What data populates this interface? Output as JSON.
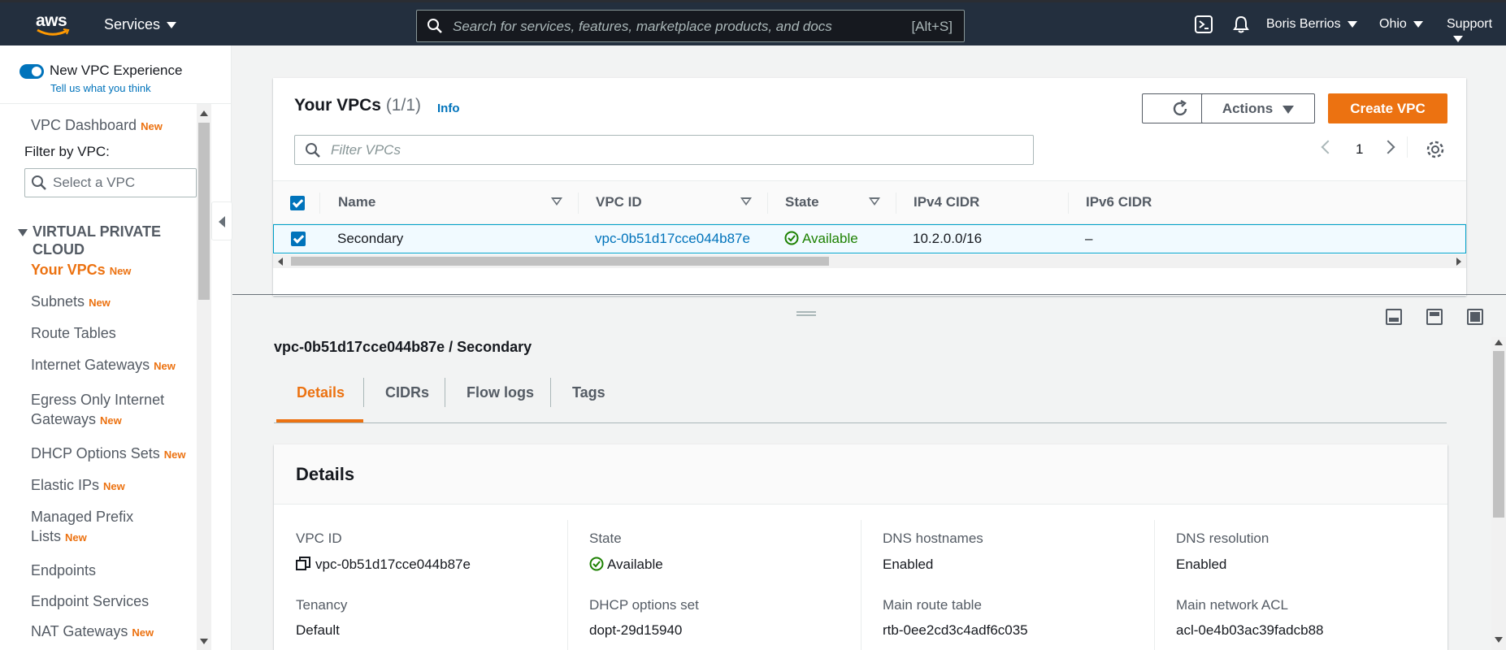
{
  "topbar": {
    "logo_text": "aws",
    "services_label": "Services",
    "search_placeholder": "Search for services, features, marketplace products, and docs",
    "search_shortcut": "[Alt+S]",
    "user_name": "Boris Berrios",
    "region": "Ohio",
    "support": "Support"
  },
  "sidebar": {
    "new_vpc_experience": "New VPC Experience",
    "tell_us": "Tell us what you think",
    "vpc_dashboard": "VPC Dashboard",
    "new_badge": "New",
    "filter_label": "Filter by VPC:",
    "select_placeholder": "Select a VPC",
    "section_title_1": "VIRTUAL PRIVATE",
    "section_title_2": "CLOUD",
    "items": [
      {
        "label": "Your VPCs",
        "badge": "New"
      },
      {
        "label": "Subnets",
        "badge": "New"
      },
      {
        "label": "Route Tables",
        "badge": ""
      },
      {
        "label": "Internet Gateways",
        "badge": "New"
      },
      {
        "label": "Egress Only Internet",
        "label2": "Gateways",
        "badge": "New"
      },
      {
        "label": "DHCP Options Sets",
        "badge": "New"
      },
      {
        "label": "Elastic IPs",
        "badge": "New"
      },
      {
        "label": "Managed Prefix",
        "label2": "Lists",
        "badge": "New"
      },
      {
        "label": "Endpoints",
        "badge": ""
      },
      {
        "label": "Endpoint Services",
        "badge": ""
      },
      {
        "label": "NAT Gateways",
        "badge": "New"
      }
    ]
  },
  "vpcs": {
    "title": "Your VPCs",
    "count": "(1/1)",
    "info": "Info",
    "actions": "Actions",
    "create": "Create VPC",
    "filter_placeholder": "Filter VPCs",
    "page": "1",
    "columns": [
      "Name",
      "VPC ID",
      "State",
      "IPv4 CIDR",
      "IPv6 CIDR"
    ],
    "row": {
      "name": "Secondary",
      "vpc_id": "vpc-0b51d17cce044b87e",
      "state": "Available",
      "ipv4": "10.2.0.0/16",
      "ipv6": "–"
    }
  },
  "detail": {
    "title": "vpc-0b51d17cce044b87e / Secondary",
    "tabs": [
      "Details",
      "CIDRs",
      "Flow logs",
      "Tags"
    ],
    "card_title": "Details",
    "fields": [
      {
        "label": "VPC ID",
        "value": "vpc-0b51d17cce044b87e"
      },
      {
        "label": "State",
        "value": "Available"
      },
      {
        "label": "DNS hostnames",
        "value": "Enabled"
      },
      {
        "label": "DNS resolution",
        "value": "Enabled"
      },
      {
        "label": "Tenancy",
        "value": "Default"
      },
      {
        "label": "DHCP options set",
        "value": "dopt-29d15940"
      },
      {
        "label": "Main route table",
        "value": "rtb-0ee2cd3c4adf6c035"
      },
      {
        "label": "Main network ACL",
        "value": "acl-0e4b03ac39fadcb88"
      }
    ]
  },
  "colors": {
    "accent": "#ec7211",
    "link": "#0073bb",
    "success": "#1d8102",
    "header": "#232f3e"
  }
}
